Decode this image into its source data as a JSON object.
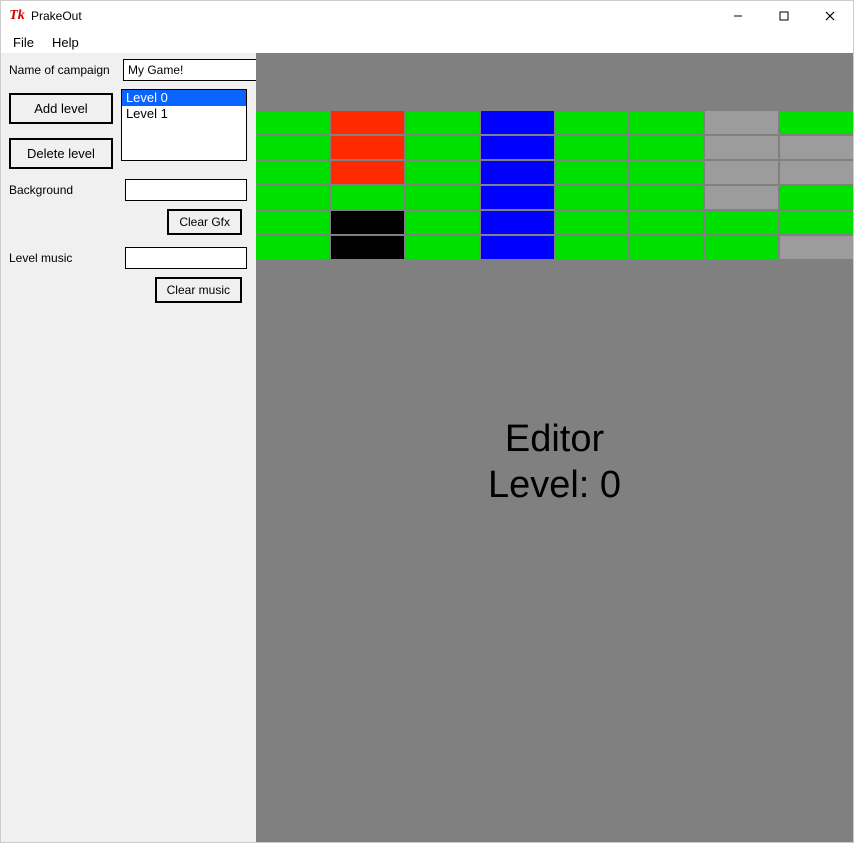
{
  "window": {
    "title": "PrakeOut",
    "icon_glyph": "Tk"
  },
  "menus": {
    "file": "File",
    "help": "Help"
  },
  "sidebar": {
    "campaign_label": "Name of campaign",
    "campaign_value": "My Game!",
    "add_level_btn": "Add level",
    "delete_level_btn": "Delete level",
    "levels": [
      "Level 0",
      "Level 1"
    ],
    "selected_level_index": 0,
    "background_label": "Background",
    "background_value": "",
    "clear_gfx_btn": "Clear Gfx",
    "level_music_label": "Level music",
    "level_music_value": "",
    "clear_music_btn": "Clear music"
  },
  "editor": {
    "line1": "Editor",
    "line2": "Level: 0",
    "columns": 8,
    "grid_colors": [
      [
        "green",
        "red",
        "green",
        "blue",
        "green",
        "green",
        "graylt",
        "green"
      ],
      [
        "green",
        "red",
        "green",
        "blue",
        "green",
        "green",
        "graylt",
        "graylt"
      ],
      [
        "green",
        "red",
        "green",
        "blue",
        "green",
        "green",
        "graylt",
        "graylt"
      ],
      [
        "green",
        "green",
        "green",
        "blue",
        "green",
        "green",
        "graylt",
        "green"
      ],
      [
        "green",
        "black",
        "green",
        "blue",
        "green",
        "green",
        "green",
        "green"
      ],
      [
        "green",
        "black",
        "green",
        "blue",
        "green",
        "green",
        "green",
        "graylt"
      ]
    ],
    "color_map": {
      "green": "#00e000",
      "red": "#ff2a00",
      "blue": "#0000ff",
      "black": "#000000",
      "gray": "#808080",
      "graylt": "#9c9c9c"
    }
  }
}
